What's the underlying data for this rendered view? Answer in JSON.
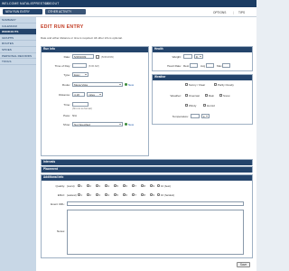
{
  "topbar": {
    "welcome": "WELCOME NATALIEPRESTON",
    "logout": "LOGOUT",
    "new_run": "NEW RUN ENTRY",
    "other_activity": "OTHER ACTIVITY",
    "options": "OPTIONS",
    "tips": "TIPS"
  },
  "sidebar": {
    "items": [
      "SUMMARY",
      "CALENDAR",
      "WORKOUTS",
      "GRAPHS",
      "ROUTES",
      "SHOES",
      "PERSONAL RECORDS",
      "TOOLS"
    ],
    "active": "WORKOUTS"
  },
  "main": {
    "title": "EDIT RUN ENTRY",
    "intro": "Date and either distance or time is required. All other info is optional."
  },
  "run_info": {
    "header": "Run Info",
    "date_label": "Date:",
    "date_value": "5/28/2009",
    "date_hint": "(5/30/2009)",
    "time_of_day_label": "Time of Day:",
    "time_of_day_hint": "(6:00 AM)",
    "type_label": "Type:",
    "type_value": "Easy",
    "route_label": "Route:",
    "route_value": "Mega Vista",
    "route_new": "New",
    "distance_label": "Distance:",
    "distance_value": "4.18",
    "distance_unit": "miles",
    "time_label": "Time:",
    "time_hint": "(hh:mm:ss format)",
    "pace_label": "Pace:",
    "pace_value": "N/A",
    "shoe_label": "Shoe:",
    "shoe_value": "Not Specified",
    "shoe_new": "New"
  },
  "health": {
    "header": "Health",
    "weight_label": "Weight:",
    "weight_unit": "lb",
    "heart_rate_label": "Heart Rate:",
    "rest_label": "Rest",
    "avg_label": "Avg",
    "max_label": "Max"
  },
  "weather": {
    "header": "Weather",
    "weather_label": "Weather:",
    "conditions": [
      "Sunny / Clear",
      "Partly Cloudy",
      "Overcast",
      "Rain",
      "Snow",
      "Windy",
      "Humid"
    ],
    "temperature_label": "Temperature:",
    "temp_unit": "F"
  },
  "intervals": {
    "header": "Intervals"
  },
  "placement": {
    "header": "Placement"
  },
  "additional": {
    "header": "Additional Info",
    "quality_label": "Quality:",
    "quality_low": "(worst)",
    "quality_high": "10 (best)",
    "effort_label": "Effort:",
    "effort_low": "(easiest)",
    "effort_high": "10 (hardest)",
    "event_url_label": "Event URL:",
    "notes_label": "Notes:"
  },
  "save_label": "Save"
}
